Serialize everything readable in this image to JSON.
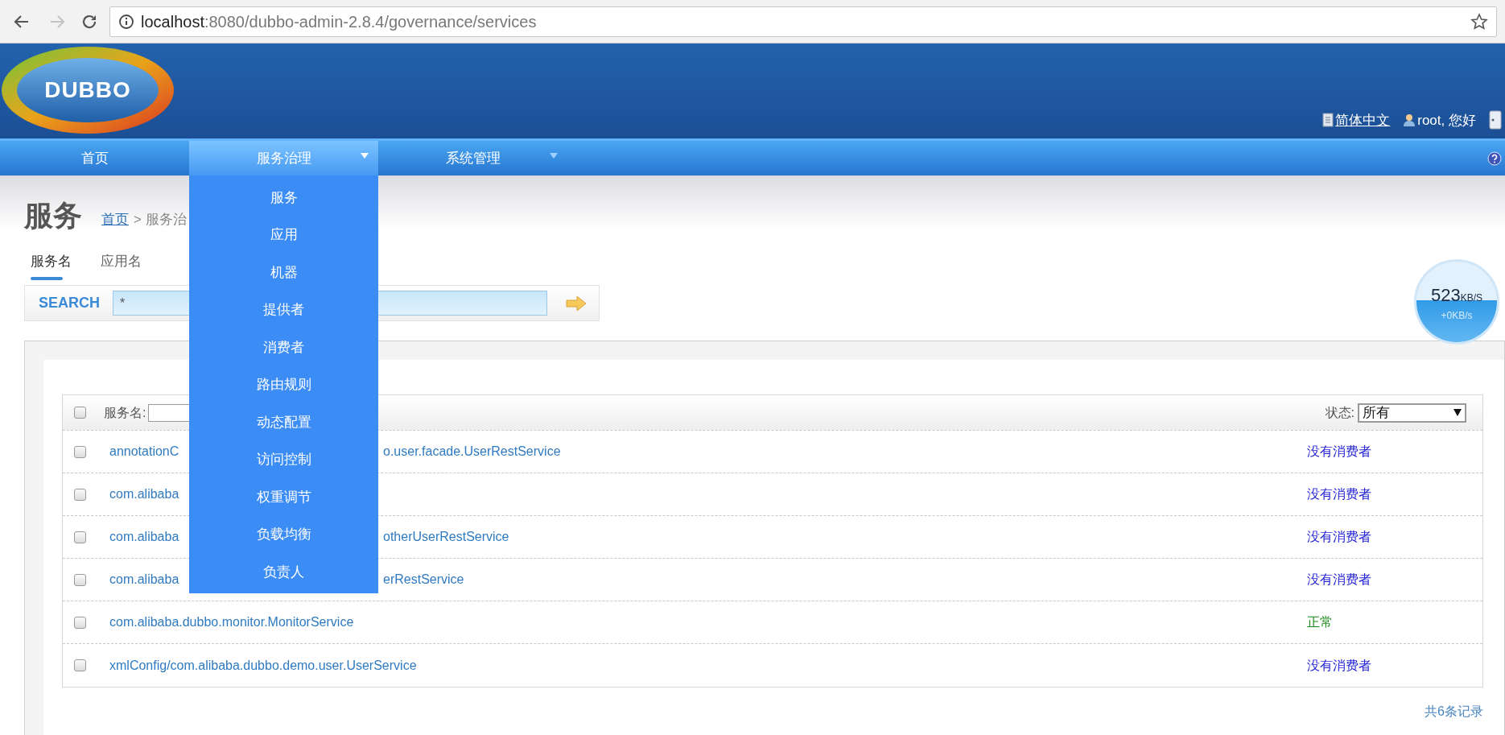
{
  "browser": {
    "url_host": "localhost",
    "url_path": ":8080/dubbo-admin-2.8.4/governance/services"
  },
  "header": {
    "logo_text": "DUBBO",
    "language": "简体中文",
    "user": "root, 您好"
  },
  "nav": [
    {
      "label": "首页",
      "selected": false,
      "has_submenu": false
    },
    {
      "label": "服务治理",
      "selected": true,
      "has_submenu": true,
      "menu": [
        "服务",
        "应用",
        "机器",
        "提供者",
        "消费者",
        "路由规则",
        "动态配置",
        "访问控制",
        "权重调节",
        "负载均衡",
        "负责人"
      ]
    },
    {
      "label": "系统管理",
      "selected": false,
      "has_submenu": true
    }
  ],
  "page": {
    "title": "服务",
    "breadcrumb_link": "首页",
    "breadcrumb_rest": "> 服务治"
  },
  "tabs": [
    {
      "label": "服务名",
      "selected": true
    },
    {
      "label": "应用名",
      "selected": false
    }
  ],
  "search": {
    "label": "SEARCH",
    "value": "*"
  },
  "speed": {
    "value": "523",
    "unit": "KB/S",
    "delta": "+0KB/s"
  },
  "table": {
    "select_all_checked": false,
    "name_filter_label": "服务名:",
    "status_label": "状态:",
    "status_value": "所有",
    "rows": [
      {
        "checked": false,
        "name": "annotationC",
        "name_tail": "o.user.facade.UserRestService",
        "status": "没有消费者",
        "color": "#1f1fd6"
      },
      {
        "checked": false,
        "name": "com.alibaba",
        "status": "没有消费者",
        "color": "#1f1fd6"
      },
      {
        "checked": false,
        "name": "com.alibaba",
        "name_tail": "otherUserRestService",
        "status": "没有消费者",
        "color": "#1f1fd6"
      },
      {
        "checked": false,
        "name": "com.alibaba",
        "name_tail": "erRestService",
        "status": "没有消费者",
        "color": "#1f1fd6"
      },
      {
        "checked": false,
        "name": "com.alibaba.dubbo.monitor.MonitorService",
        "status": "正常",
        "color": "#1a8a1a"
      },
      {
        "checked": false,
        "name": "xmlConfig/com.alibaba.dubbo.demo.user.UserService",
        "status": "没有消费者",
        "color": "#1f1fd6"
      }
    ],
    "total": "共6条记录"
  }
}
